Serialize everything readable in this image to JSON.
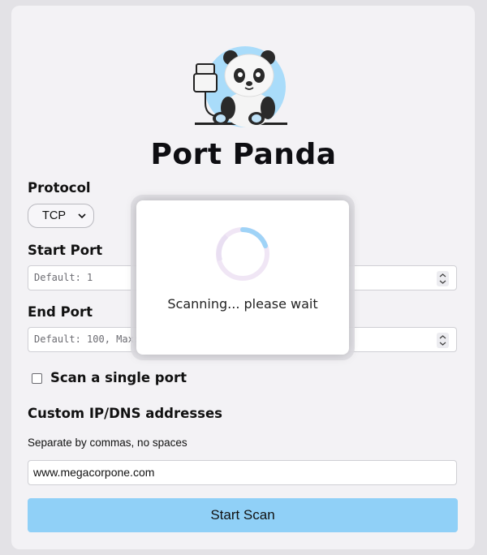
{
  "app": {
    "title": "Port Panda"
  },
  "protocol": {
    "label": "Protocol",
    "selected": "TCP"
  },
  "start_port": {
    "label": "Start Port",
    "placeholder": "Default: 1"
  },
  "end_port": {
    "label": "End Port",
    "placeholder": "Default: 100, Max: 6"
  },
  "single_port": {
    "label": "Scan a single port",
    "checked": false
  },
  "custom_ip": {
    "label": "Custom IP/DNS addresses",
    "hint": "Separate by commas, no spaces",
    "value": "www.megacorpone.com"
  },
  "actions": {
    "start_scan": "Start Scan"
  },
  "modal": {
    "message": "Scanning... please wait"
  },
  "colors": {
    "accent": "#90d0f7",
    "spinner": "#9fd3f7"
  }
}
